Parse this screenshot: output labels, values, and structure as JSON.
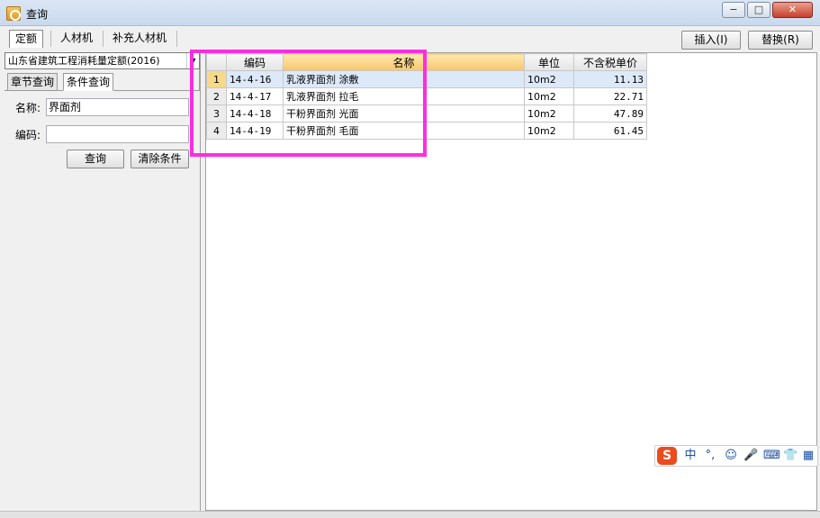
{
  "window": {
    "title": "查询",
    "minimize": "−",
    "maximize": "□",
    "close": "✕"
  },
  "top_tabs": [
    {
      "label": "定额",
      "active": true
    },
    {
      "label": "人材机",
      "active": false
    },
    {
      "label": "补充人材机",
      "active": false
    }
  ],
  "actions": {
    "insert": "插入(I)",
    "replace": "替换(R)"
  },
  "left": {
    "library": "山东省建筑工程消耗量定额(2016)",
    "subtabs": [
      "章节查询",
      "条件查询"
    ],
    "name_label": "名称:",
    "name_value": "界面剂",
    "code_label": "编码:",
    "code_value": "",
    "query_button": "查询",
    "clear_button": "清除条件"
  },
  "table": {
    "columns": [
      "",
      "编码",
      "名称",
      "单位",
      "不含税单价"
    ],
    "rows": [
      {
        "n": "1",
        "code": "14-4-16",
        "name": "乳液界面剂 涂敷",
        "unit": "10m2",
        "price": "11.13"
      },
      {
        "n": "2",
        "code": "14-4-17",
        "name": "乳液界面剂 拉毛",
        "unit": "10m2",
        "price": "22.71"
      },
      {
        "n": "3",
        "code": "14-4-18",
        "name": "干粉界面剂 光面",
        "unit": "10m2",
        "price": "47.89"
      },
      {
        "n": "4",
        "code": "14-4-19",
        "name": "干粉界面剂 毛面",
        "unit": "10m2",
        "price": "61.45"
      }
    ]
  },
  "ime": {
    "logo": "S",
    "items": [
      "中",
      "°,",
      "☺",
      "🎤",
      "⌨",
      "👕",
      "▦"
    ]
  },
  "colors": {
    "highlight": "#ff2de0",
    "sorted_header": "#f7c76b",
    "selected_row": "#dde9f8"
  }
}
